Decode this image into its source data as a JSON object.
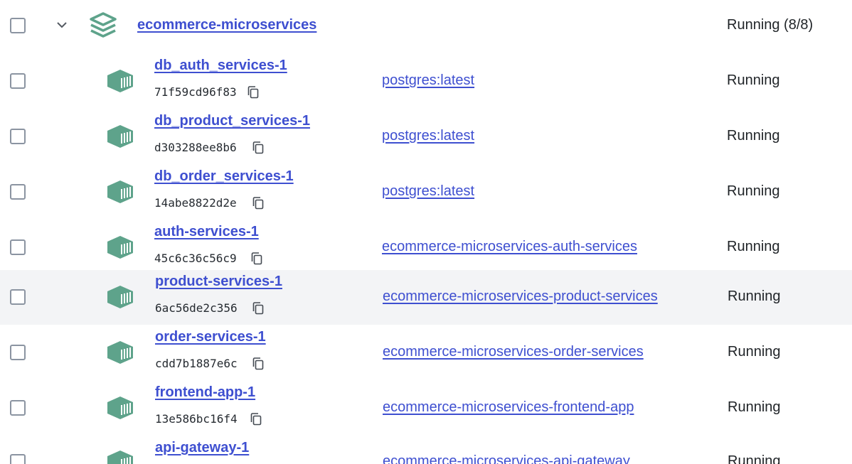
{
  "project": {
    "name": "ecommerce-microservices",
    "status": "Running (8/8)"
  },
  "colors": {
    "link": "#3e4fd0",
    "icon": "#5ea38b",
    "checkbox": "#8b94a1",
    "row_highlight": "#f3f4f6"
  },
  "containers": [
    {
      "name": "db_auth_services-1",
      "id": "71f59cd96f83",
      "image": "postgres:latest",
      "status": "Running"
    },
    {
      "name": "db_product_services-1",
      "id": "d303288ee8b6",
      "image": "postgres:latest",
      "status": "Running"
    },
    {
      "name": "db_order_services-1",
      "id": "14abe8822d2e",
      "image": "postgres:latest",
      "status": "Running"
    },
    {
      "name": "auth-services-1",
      "id": "45c6c36c56c9",
      "image": "ecommerce-microservices-auth-services",
      "status": "Running"
    },
    {
      "name": "product-services-1",
      "id": "6ac56de2c356",
      "image": "ecommerce-microservices-product-services",
      "status": "Running"
    },
    {
      "name": "order-services-1",
      "id": "cdd7b1887e6c",
      "image": "ecommerce-microservices-order-services",
      "status": "Running"
    },
    {
      "name": "frontend-app-1",
      "id": "13e586bc16f4",
      "image": "ecommerce-microservices-frontend-app",
      "status": "Running"
    },
    {
      "name": "api-gateway-1",
      "id": "",
      "image": "ecommerce-microservices-api-gateway",
      "status": "Running"
    }
  ]
}
